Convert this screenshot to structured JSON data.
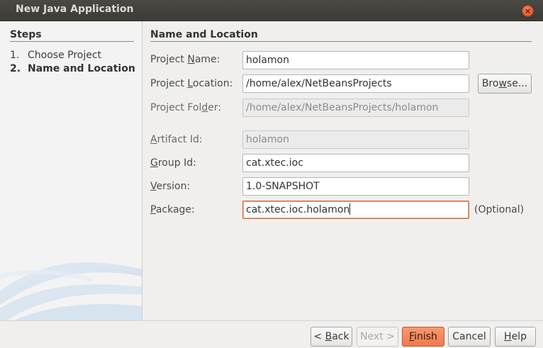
{
  "window": {
    "title": "New Java Application",
    "close_glyph": "×"
  },
  "steps": {
    "heading": "Steps",
    "items": [
      {
        "num": "1.",
        "label": "Choose Project"
      },
      {
        "num": "2.",
        "label": "Name and Location"
      }
    ]
  },
  "panel": {
    "heading": "Name and Location",
    "project_name": {
      "label_pre": "Project ",
      "label_mn": "N",
      "label_post": "ame:",
      "value": "holamon"
    },
    "project_location": {
      "label_pre": "Project ",
      "label_mn": "L",
      "label_post": "ocation:",
      "value": "/home/alex/NetBeansProjects"
    },
    "project_folder": {
      "label_pre": "Project Fol",
      "label_mn": "d",
      "label_post": "er:",
      "value": "/home/alex/NetBeansProjects/holamon"
    },
    "artifact_id": {
      "label_pre": "",
      "label_mn": "A",
      "label_post": "rtifact Id:",
      "value": "holamon"
    },
    "group_id": {
      "label_pre": "",
      "label_mn": "G",
      "label_post": "roup Id:",
      "value": "cat.xtec.ioc"
    },
    "version": {
      "label_pre": "",
      "label_mn": "V",
      "label_post": "ersion:",
      "value": "1.0-SNAPSHOT"
    },
    "package": {
      "label_pre": "",
      "label_mn": "P",
      "label_post": "ackage:",
      "value": "cat.xtec.ioc.holamon"
    },
    "optional_note": "(Optional)",
    "browse": {
      "pre": "Bro",
      "mn": "w",
      "post": "se..."
    }
  },
  "buttons": {
    "back": {
      "pre": "< ",
      "mn": "B",
      "post": "ack"
    },
    "next": {
      "pre": "Next ",
      "mn": "",
      "post": ">"
    },
    "finish": {
      "pre": "",
      "mn": "F",
      "post": "inish"
    },
    "cancel": {
      "pre": "",
      "mn": "",
      "post": "Cancel"
    },
    "help": {
      "pre": "",
      "mn": "H",
      "post": "elp"
    }
  },
  "colors": {
    "accent": "#ee7a4e",
    "titlebar": "#3c3b37",
    "dialog_bg": "#f0efee",
    "focus_border": "#d2713c"
  }
}
